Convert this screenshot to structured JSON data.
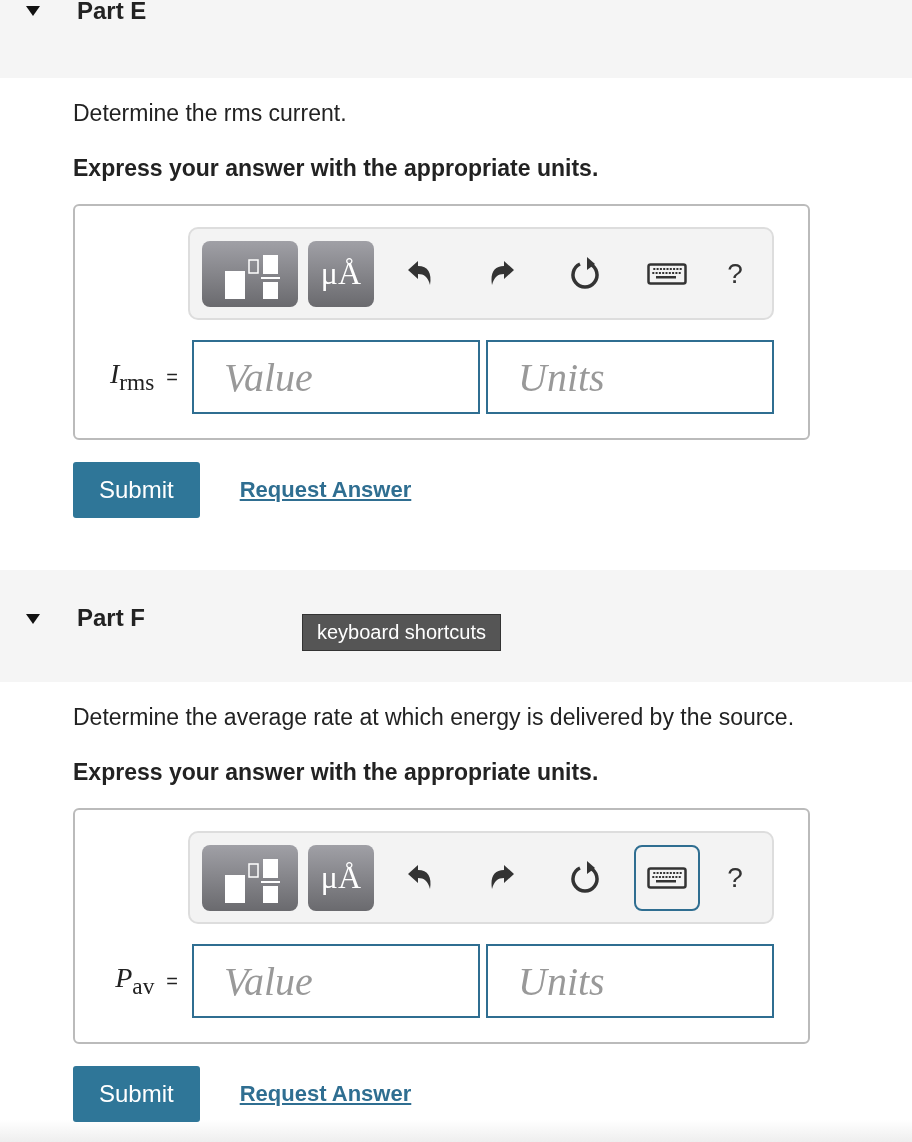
{
  "parts": [
    {
      "title": "Part E",
      "expanded": true,
      "question": "Determine the rms current.",
      "instruction": "Express your answer with the appropriate units.",
      "variable": "*I*$_{rms}$",
      "equals": "=",
      "value_placeholder": "Value",
      "units_placeholder": "Units",
      "units_button": "μÅ",
      "help": "?",
      "keyboard_focused": false,
      "submit": "Submit",
      "request": "Request Answer"
    },
    {
      "title": "Part F",
      "expanded": true,
      "tooltip": "keyboard shortcuts",
      "question": "Determine the average rate at which energy is delivered by the source.",
      "instruction": "Express your answer with the appropriate units.",
      "variable": "*P*$_{av}$",
      "equals": "=",
      "value_placeholder": "Value",
      "units_placeholder": "Units",
      "units_button": "μÅ",
      "help": "?",
      "keyboard_focused": true,
      "submit": "Submit",
      "request": "Request Answer"
    }
  ]
}
